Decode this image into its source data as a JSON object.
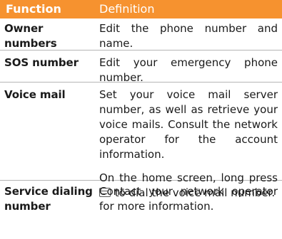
{
  "header": {
    "function": "Function",
    "definition": "Definition"
  },
  "rows": [
    {
      "function": "Owner numbers",
      "definition": "Edit the phone number and name."
    },
    {
      "function": "SOS number",
      "definition": "Edit your emergency phone number."
    },
    {
      "function": "Voice mail",
      "definition": "Set your voice mail server number, as well as retrieve your voice mails. Consult the network operator for the account information.",
      "definition_extra_before_icon": "On the home screen, long press",
      "definition_extra_after_icon": "to dial the voice mail number.",
      "key_icon": "key-1-voicemail-icon"
    },
    {
      "function": "Service dialing number",
      "definition": "Contact your network operator for more information."
    }
  ],
  "colors": {
    "header_bg": "#f6922f",
    "header_text": "#ffffff",
    "divider": "#b5b5b5"
  }
}
